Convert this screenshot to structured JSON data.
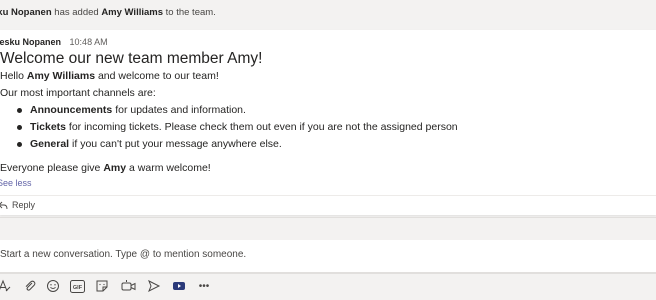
{
  "system_message": {
    "actor": "sku Nopanen",
    "action": "has added",
    "target": "Amy Williams",
    "suffix": "to the team."
  },
  "post": {
    "author": "Vesku Nopanen",
    "time": "10:48 AM",
    "subject": "Welcome our new team member Amy!",
    "greeting_prefix": "Hello",
    "greeting_name": "Amy Williams",
    "greeting_suffix": "and welcome to our team!",
    "channels_intro": "Our most important channels are:",
    "channels": [
      {
        "name": "Announcements",
        "description": "for updates and information."
      },
      {
        "name": "Tickets",
        "description": "for incoming tickets. Please check them out even if you are not the assigned person"
      },
      {
        "name": "General",
        "description": "if you can't put your message anywhere else."
      }
    ],
    "closing_prefix": "Everyone please give",
    "closing_name": "Amy",
    "closing_suffix": "a warm welcome!",
    "see_less": "See less",
    "reply": "Reply"
  },
  "compose": {
    "placeholder": "Start a new conversation. Type @ to mention someone."
  },
  "toolbar": {
    "icons": [
      "format-icon",
      "attach-icon",
      "emoji-icon",
      "gif-icon",
      "sticker-icon",
      "meet-now-icon",
      "praise-icon",
      "stream-icon",
      "more-options-icon"
    ],
    "gif_label": "GIF",
    "more_label": "•••"
  },
  "colors": {
    "accent": "#6264a7",
    "background": "#f3f2f1",
    "card": "#ffffff"
  }
}
